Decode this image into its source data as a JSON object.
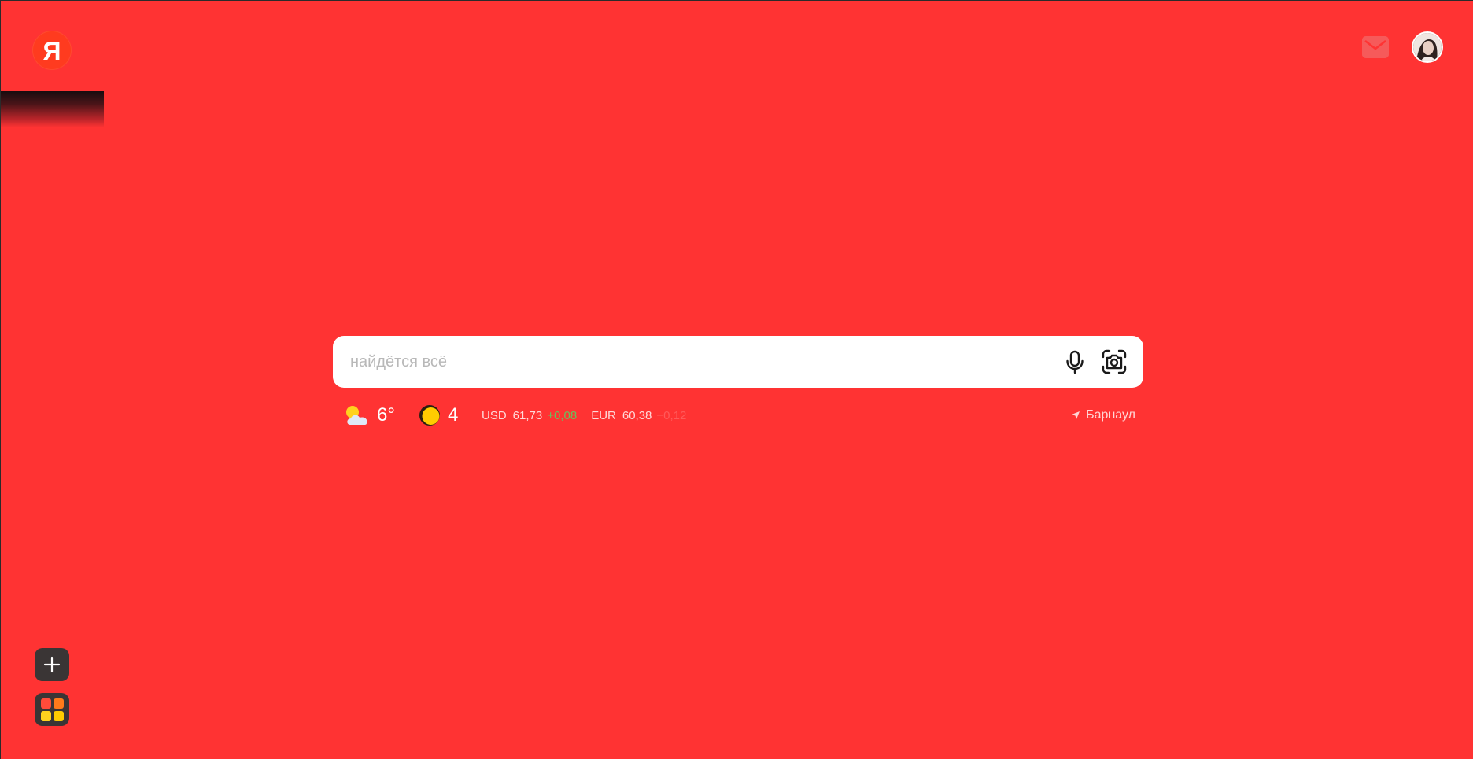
{
  "header": {
    "logo_text": "Я",
    "mail_icon": "mail-icon",
    "avatar_icon": "user-avatar"
  },
  "search": {
    "placeholder": "найдётся всё",
    "value": "",
    "voice_icon": "microphone-icon",
    "camera_icon": "camera-icon"
  },
  "informers": {
    "weather": {
      "icon": "partly-cloudy-icon",
      "temperature": "6°"
    },
    "traffic": {
      "icon": "traffic-light-icon",
      "score": "4"
    },
    "rates": [
      {
        "code": "USD",
        "value": "61,73",
        "change": "+0,08",
        "direction": "up"
      },
      {
        "code": "EUR",
        "value": "60,38",
        "change": "−0,12",
        "direction": "down"
      }
    ],
    "location": {
      "icon": "location-arrow-icon",
      "city": "Барнаул"
    }
  },
  "sidebar": {
    "add_icon": "plus-icon",
    "apps_icon": "apps-grid-icon"
  },
  "colors": {
    "background": "#ff3333",
    "search_bg": "#ffffff",
    "rate_up": "#6bbf5c",
    "rate_down": "#ff5a5a",
    "dark_button": "#3a3535"
  }
}
